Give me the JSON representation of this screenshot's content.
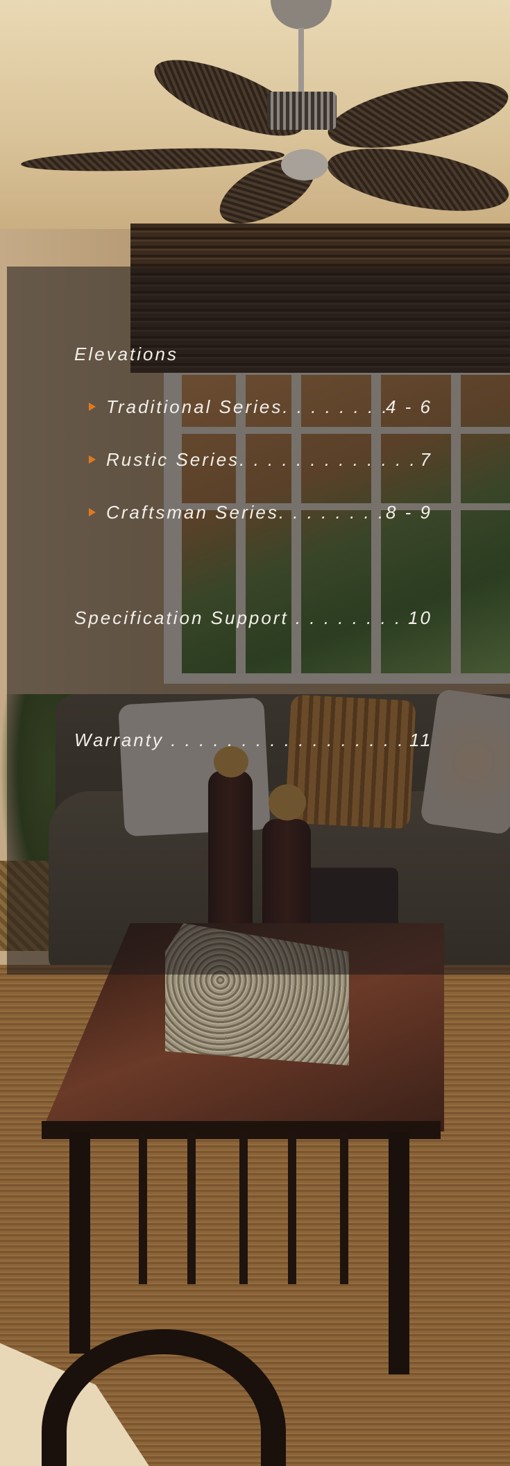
{
  "toc": {
    "elevations": {
      "label": "Elevations"
    },
    "series": [
      {
        "label": "Traditional Series. . . . . . . .",
        "pages": "4 - 6"
      },
      {
        "label": "Rustic Series. . . . . . . . . . . . .",
        "pages": "7"
      },
      {
        "label": "Craftsman Series. . . . . . . .",
        "pages": "8 - 9"
      }
    ],
    "specification": {
      "label": "Specification Support . . . . . . . . .",
      "pages": "10"
    },
    "warranty": {
      "label": "Warranty . . . . . . . . . . . . . . . . . . .",
      "pages": "11"
    }
  },
  "colors": {
    "bullet": "#e07a1e",
    "text": "#f2efe9",
    "overlay": "rgba(28,24,26,0.55)"
  }
}
